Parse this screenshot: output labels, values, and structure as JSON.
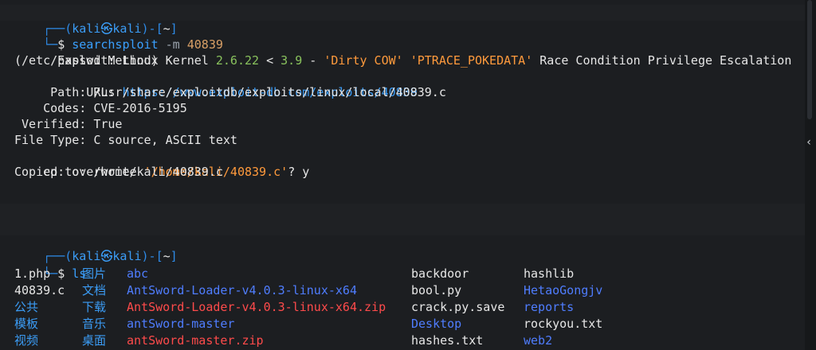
{
  "prompt1": {
    "frame_top": "┌──",
    "open_paren": "(",
    "user": "kali",
    "at": "㉿",
    "host": "kali",
    "close_paren": ")",
    "dash": "-",
    "cwd_open": "[",
    "cwd": "~",
    "cwd_close": "]",
    "frame_bottom": "└─",
    "dollar": "$ ",
    "command": "searchsploit",
    "args": " -m ",
    "arg_value": "40839"
  },
  "output": {
    "exploit_label": "  Exploit: Linux Kernel ",
    "exploit_ver1": "2.6.22",
    "exploit_lt": " < ",
    "exploit_ver2": "3.9",
    "exploit_dash": " - ",
    "exploit_q1": "'Dirty COW'",
    "exploit_space": " ",
    "exploit_q2": "'PTRACE_POKEDATA'",
    "exploit_rest": " Race Condition Privilege Escalation",
    "exploit_cont": "(/etc/passwd Method)",
    "url_label": "      URL: ",
    "url_value": "https://www.exploit-db.com/exploits/40839",
    "path_line": "     Path: /usr/share/exploitdb/exploits/linux/local/40839.c",
    "codes_line": "    Codes: CVE-2016-5195",
    "verified_line": " Verified: True",
    "filetype_line": "File Type: C source, ASCII text",
    "cp_prefix": "cp: overwrite ",
    "cp_target": "'/home/kali/40839.c'",
    "cp_suffix": "? y",
    "copied_line": "Copied to: /home/kali/40839.c"
  },
  "prompt2": {
    "command": "ls"
  },
  "ls": {
    "col1": [
      "1.php",
      "40839.c",
      "公共",
      "模板",
      "视频"
    ],
    "col2": [
      "图片",
      "文档",
      "下载",
      "音乐",
      "桌面"
    ],
    "col3": [
      "abc",
      "AntSword-Loader-v4.0.3-linux-x64",
      "AntSword-Loader-v4.0.3-linux-x64.zip",
      "antSword-master",
      "antSword-master.zip"
    ],
    "col4": [
      "backdoor",
      "bool.py",
      "crack.py.save",
      "Desktop",
      "hashes.txt"
    ],
    "col5": [
      "hashlib",
      "HetaoGongjv",
      "reports",
      "rockyou.txt",
      "web2"
    ]
  },
  "ui": {
    "chevron": "‹"
  }
}
